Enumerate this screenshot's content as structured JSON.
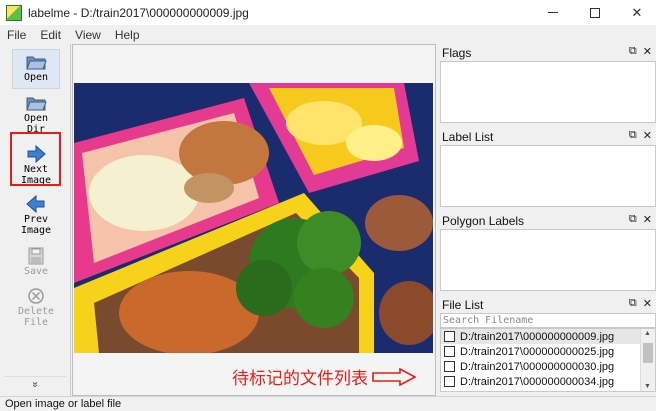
{
  "window": {
    "title": "labelme - D:/train2017\\000000000009.jpg",
    "minimize_glyph": "─",
    "maximize_glyph": "□",
    "close_glyph": "✕"
  },
  "menu": [
    "File",
    "Edit",
    "View",
    "Help"
  ],
  "toolbar": {
    "open": "Open",
    "open_dir": "Open\nDir",
    "next_image": "Next\nImage",
    "prev_image": "Prev\nImage",
    "save": "Save",
    "delete_file": "Delete\nFile",
    "more": "»"
  },
  "docks": {
    "flags_title": "Flags",
    "label_list_title": "Label List",
    "polygon_labels_title": "Polygon Labels",
    "file_list_title": "File List",
    "float_glyph": "⧉",
    "close_glyph": "✕"
  },
  "file_list": {
    "search_placeholder": "Search Filename",
    "files": [
      "D:/train2017\\000000000009.jpg",
      "D:/train2017\\000000000025.jpg",
      "D:/train2017\\000000000030.jpg",
      "D:/train2017\\000000000034.jpg"
    ]
  },
  "annotation": {
    "text": "待标记的文件列表",
    "color": "#e0201a"
  },
  "status": "Open image or label file",
  "colors": {
    "accent_red": "#e0201a",
    "selection": "#dfe7f2"
  }
}
